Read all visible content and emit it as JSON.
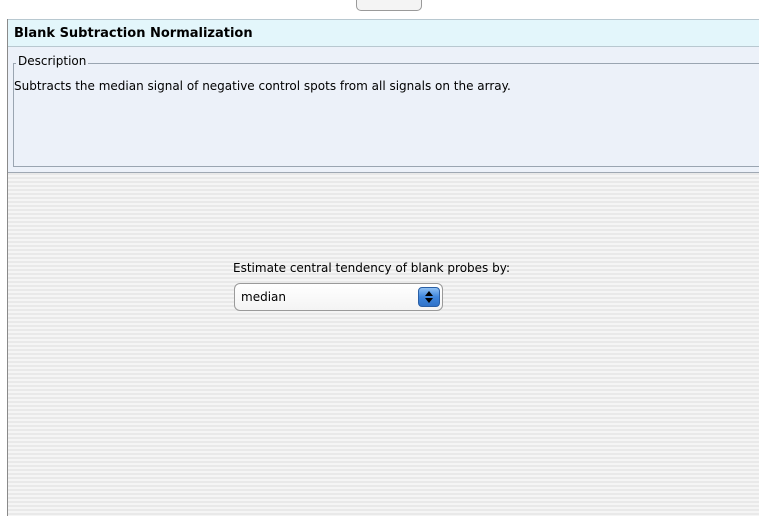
{
  "panel": {
    "title": "Blank Subtraction Normalization",
    "description_label": "Description",
    "description_text": "Subtracts the median signal of negative control spots from all signals on the array."
  },
  "settings": {
    "central_tendency_label": "Estimate central tendency of blank probes by:",
    "central_tendency_value": "median",
    "central_tendency_icon": "up-down-arrows-icon"
  },
  "colors": {
    "title_bar": "#e3f6fb",
    "description_panel": "#ecf1f9",
    "select_accent": "#3f86dc"
  }
}
